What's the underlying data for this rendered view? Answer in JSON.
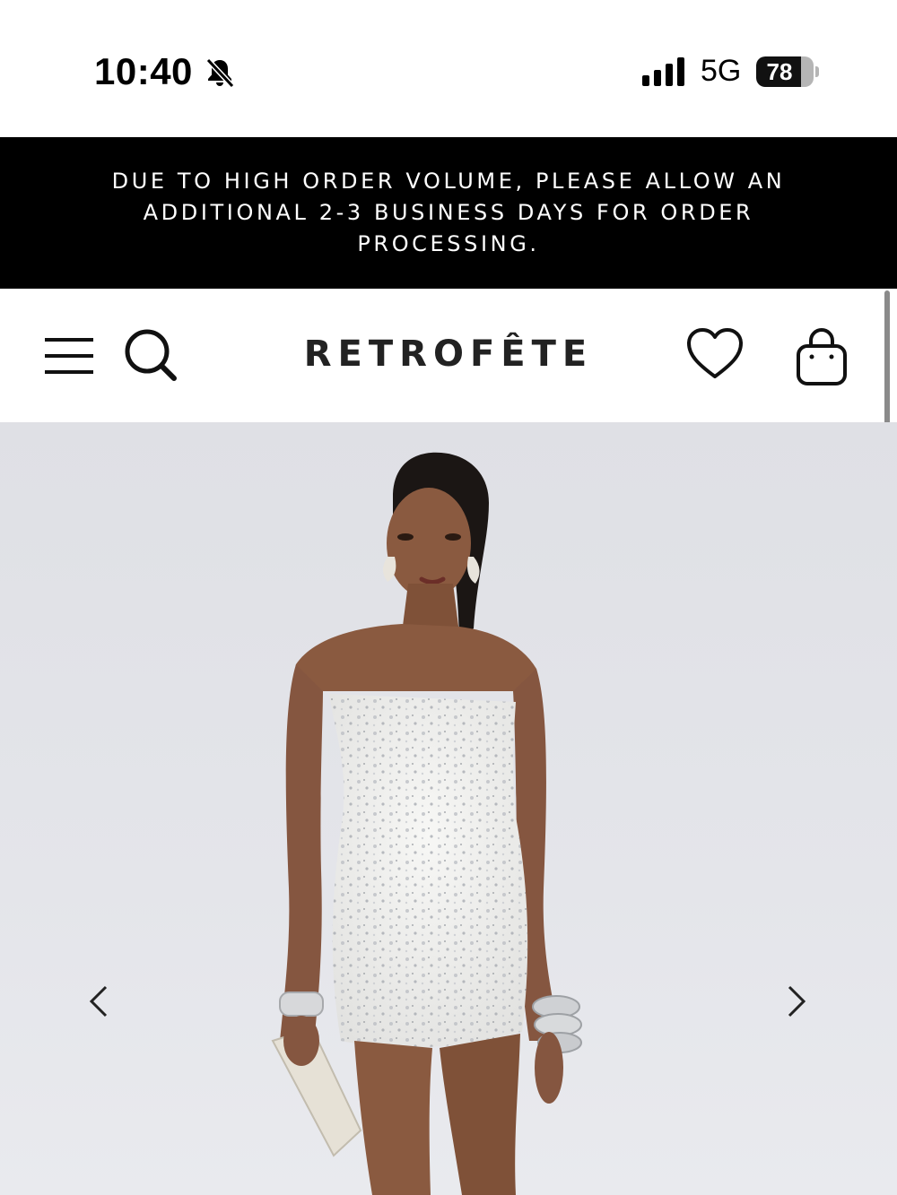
{
  "status_bar": {
    "time": "10:40",
    "network": "5G",
    "battery_percent": "78",
    "battery_level": 0.78,
    "icons": [
      "bell-muted-icon",
      "signal-icon",
      "battery-icon"
    ]
  },
  "announcement": {
    "text": "DUE TO HIGH ORDER VOLUME, PLEASE ALLOW AN ADDITIONAL 2-3 BUSINESS DAYS FOR ORDER PROCESSING."
  },
  "header": {
    "brand": "RETROFÊTE",
    "icons": [
      "menu-icon",
      "search-icon",
      "heart-icon",
      "bag-icon"
    ]
  },
  "gallery": {
    "image_subject": "model in strapless white sequin mini dress",
    "nav_icons": [
      "chevron-left-icon",
      "chevron-right-icon"
    ]
  }
}
